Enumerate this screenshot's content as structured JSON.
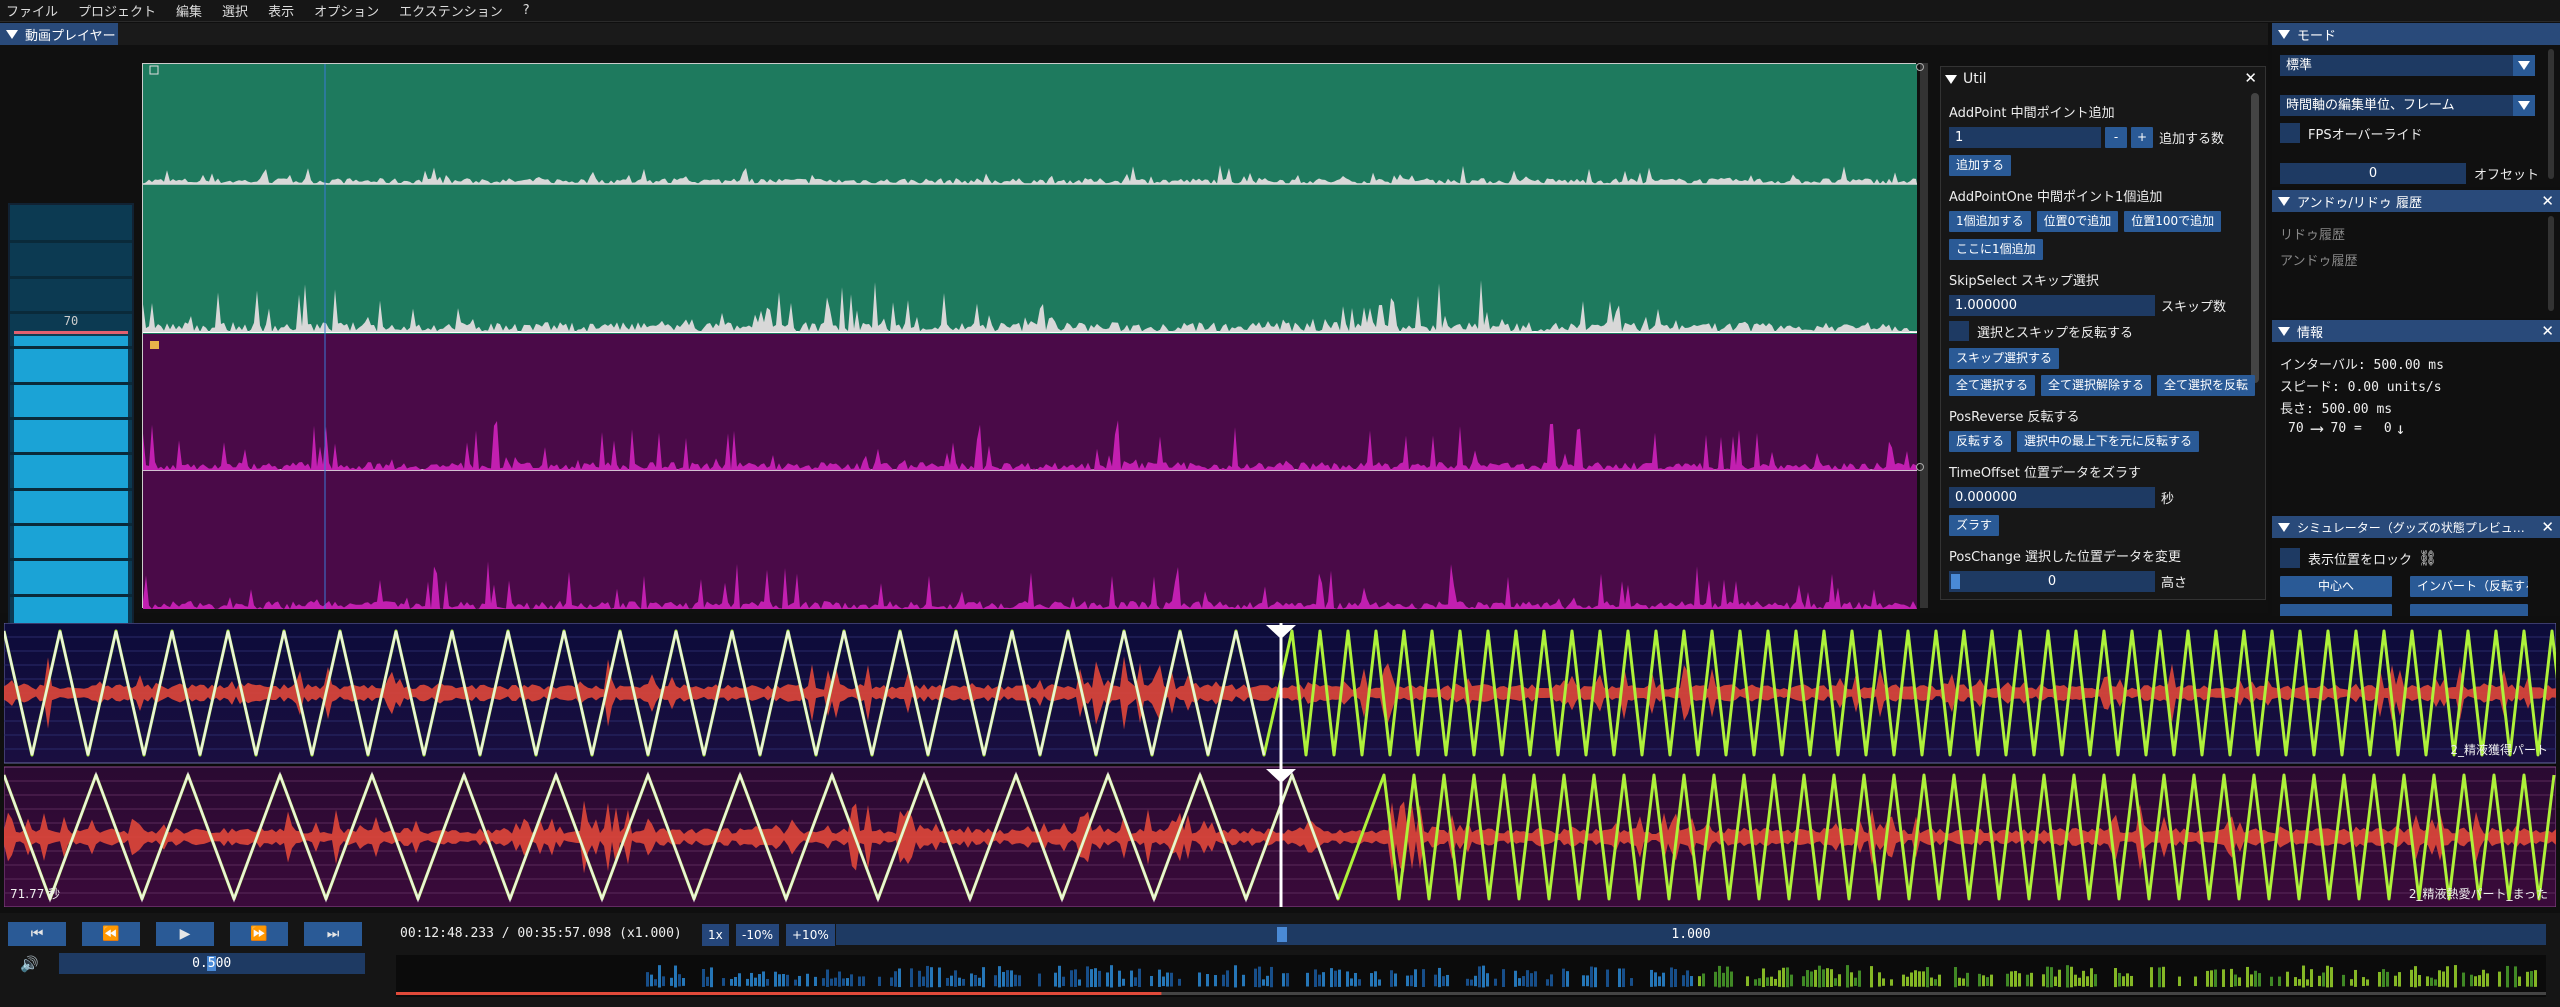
{
  "menu": [
    "ファイル",
    "プロジェクト",
    "編集",
    "選択",
    "表示",
    "オプション",
    "エクステンション",
    "?"
  ],
  "video_panel": {
    "title": "動画プレイヤー"
  },
  "level_meter": {
    "value": "70",
    "fill_fraction": 0.7
  },
  "util": {
    "title": "Util",
    "addpoint": {
      "title": "AddPoint 中間ポイント追加",
      "value": "1",
      "minus": "-",
      "plus": "+",
      "count_label": "追加する数",
      "add_btn": "追加する"
    },
    "addpointone": {
      "title": "AddPointOne 中間ポイント1個追加",
      "btn1": "1個追加する",
      "btn2": "位置0で追加",
      "btn3": "位置100で追加",
      "btn4": "ここに1個追加"
    },
    "skipselect": {
      "title": "SkipSelect スキップ選択",
      "value": "1.000000",
      "label": "スキップ数",
      "invert_label": "選択とスキップを反転する",
      "btn_skip": "スキップ選択する",
      "btn_all": "全て選択する",
      "btn_clear": "全て選択解除する",
      "btn_invert": "全て選択を反転"
    },
    "posreverse": {
      "title": "PosReverse 反転する",
      "btn1": "反転する",
      "btn2": "選択中の最上下を元に反転する"
    },
    "timeoffset": {
      "title": "TimeOffset 位置データをズラす",
      "value": "0.000000",
      "unit": "秒",
      "btn": "ズラす"
    },
    "poschange": {
      "title": "PosChange 選択した位置データを変更",
      "value": "0",
      "label": "高さ"
    }
  },
  "mode": {
    "title": "モード",
    "preset": "標準",
    "unit": "時間軸の編集単位、フレーム",
    "fps_label": "FPSオーバーライド",
    "offset_value": "0",
    "offset_label": "オフセット"
  },
  "undo": {
    "title": "アンドゥ/リドゥ 履歴",
    "redo": "リドゥ履歴",
    "undo": "アンドゥ履歴"
  },
  "info": {
    "title": "情報",
    "interval": "インターバル: 500.00 ms",
    "speed": "スピード: 0.00 units/s",
    "length": "長さ: 500.00 ms",
    "from": "70",
    "to": "70 =",
    "delta": "0"
  },
  "simulator": {
    "title": "シミュレーター（グッズの状態プレビュ…",
    "lock_label": "表示位置をロック",
    "btn_center": "中心へ",
    "btn_invert": "インバート（反転する"
  },
  "tracks": [
    {
      "label": "2_精液獲得パート"
    },
    {
      "label": "2_精液熱愛パート_まった"
    }
  ],
  "track_time": "71.77 秒",
  "transport": {
    "time": "00:12:48.233 / 00:35:57.098 (x1.000)",
    "speed_1x": "1x",
    "speed_minus": "-10%",
    "speed_plus": "+10%",
    "speed_value": "1.000",
    "speed_fraction": 0.258,
    "volume": "0.500",
    "volume_fraction": 0.5,
    "progress_fraction": 0.356
  },
  "colors": {
    "accent": "#2a5a96",
    "green_track": "#1e7a5e",
    "purple_track": "#4a0a48",
    "funscript": "#aef23a"
  }
}
